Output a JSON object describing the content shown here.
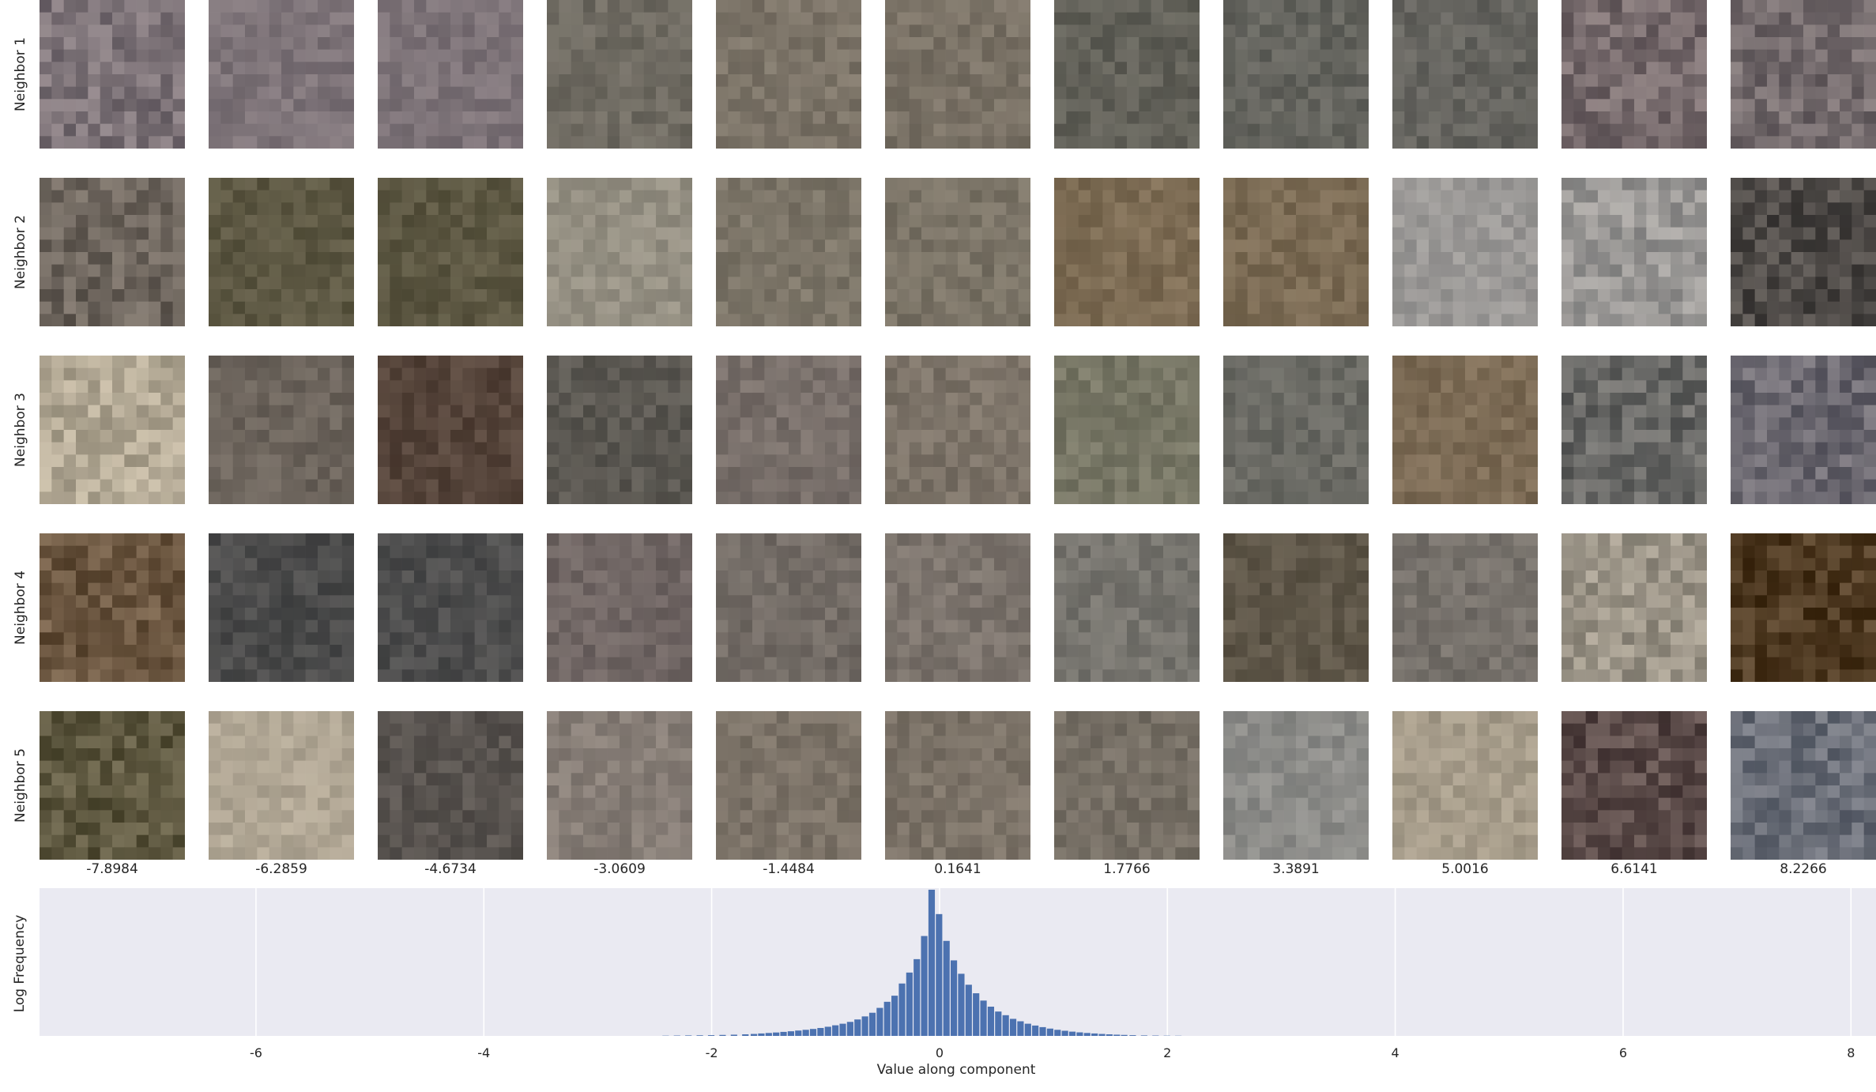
{
  "row_labels": [
    "Neighbor 1",
    "Neighbor 2",
    "Neighbor 3",
    "Neighbor 4",
    "Neighbor 5"
  ],
  "column_values": [
    "-7.8984",
    "-6.2859",
    "-4.6734",
    "-3.0609",
    "-1.4484",
    "0.1641",
    "1.7766",
    "3.3891",
    "5.0016",
    "6.6141",
    "8.2266"
  ],
  "tile_colors": [
    [
      "#7d7378",
      "#7d7378",
      "#7d7378",
      "#6f6b62",
      "#7c7468",
      "#7a7266",
      "#626159",
      "#64645e",
      "#65645f",
      "#766a6c",
      "#736a6c"
    ],
    [
      "#6c645c",
      "#5d5843",
      "#5c5742",
      "#959083",
      "#7c7568",
      "#7a7366",
      "#7d6c54",
      "#7b6b54",
      "#9a9896",
      "#9a9896",
      "#4e4a47"
    ],
    [
      "#b3a995",
      "#6c645c",
      "#55443a",
      "#5b5852",
      "#786f6a",
      "#7c7368",
      "#787766",
      "#6a6a64",
      "#7c6b55",
      "#676765",
      "#6b6870"
    ],
    [
      "#6b5640",
      "#4b4b4b",
      "#4d4d4d",
      "#6f6563",
      "#726b65",
      "#7c746d",
      "#76746e",
      "#5f5749",
      "#76716b",
      "#9b9487",
      "#4f3a22"
    ],
    [
      "#5e5840",
      "#b0a694",
      "#58534f",
      "#867d76",
      "#7c7368",
      "#7c7368",
      "#766f65",
      "#8b8b88",
      "#a69c8a",
      "#5a4a48",
      "#6a6e78"
    ]
  ],
  "chart_data": {
    "type": "bar",
    "xlabel": "Value along component",
    "ylabel": "Log Frequency",
    "xlim": [
      -7.9,
      8.22
    ],
    "xticks": [
      "-6",
      "-4",
      "-2",
      "0",
      "2",
      "4",
      "6",
      "8"
    ],
    "tick_values": [
      -6,
      -4,
      -2,
      0,
      2,
      4,
      6,
      8
    ],
    "grid": true,
    "bar_color": "#4c72b0",
    "background": "#eaeaf2",
    "bin_width": 0.065,
    "bin_centers": [
      -2.4,
      -2.3,
      -2.2,
      -2.1,
      -2.0,
      -1.9,
      -1.8,
      -1.7,
      -1.625,
      -1.56,
      -1.495,
      -1.43,
      -1.365,
      -1.3,
      -1.235,
      -1.17,
      -1.105,
      -1.04,
      -0.975,
      -0.91,
      -0.845,
      -0.78,
      -0.715,
      -0.65,
      -0.585,
      -0.52,
      -0.455,
      -0.39,
      -0.325,
      -0.26,
      -0.195,
      -0.13,
      -0.065,
      0.0,
      0.065,
      0.13,
      0.195,
      0.26,
      0.325,
      0.39,
      0.455,
      0.52,
      0.585,
      0.65,
      0.715,
      0.78,
      0.845,
      0.91,
      0.975,
      1.04,
      1.105,
      1.17,
      1.235,
      1.3,
      1.365,
      1.43,
      1.495,
      1.56,
      1.625,
      1.7,
      1.8,
      1.9,
      2.0,
      2.1
    ],
    "log_frequency": [
      0.2,
      0.3,
      0.4,
      0.5,
      0.6,
      0.8,
      1.0,
      1.3,
      1.6,
      2.0,
      2.4,
      2.8,
      3.3,
      3.8,
      4.4,
      5.0,
      5.7,
      6.5,
      7.5,
      8.7,
      10.0,
      11.5,
      13.5,
      16.0,
      19.0,
      23.0,
      28.0,
      33.0,
      43.0,
      52.0,
      63.0,
      82.0,
      120.0,
      100.0,
      78.0,
      62.0,
      51.0,
      42.0,
      35.0,
      29.0,
      24.0,
      20.0,
      17.0,
      14.0,
      12.0,
      10.0,
      8.5,
      7.2,
      6.0,
      5.0,
      4.2,
      3.5,
      2.9,
      2.4,
      2.0,
      1.6,
      1.3,
      1.0,
      0.8,
      0.6,
      0.4,
      0.3,
      0.2,
      0.15
    ]
  }
}
